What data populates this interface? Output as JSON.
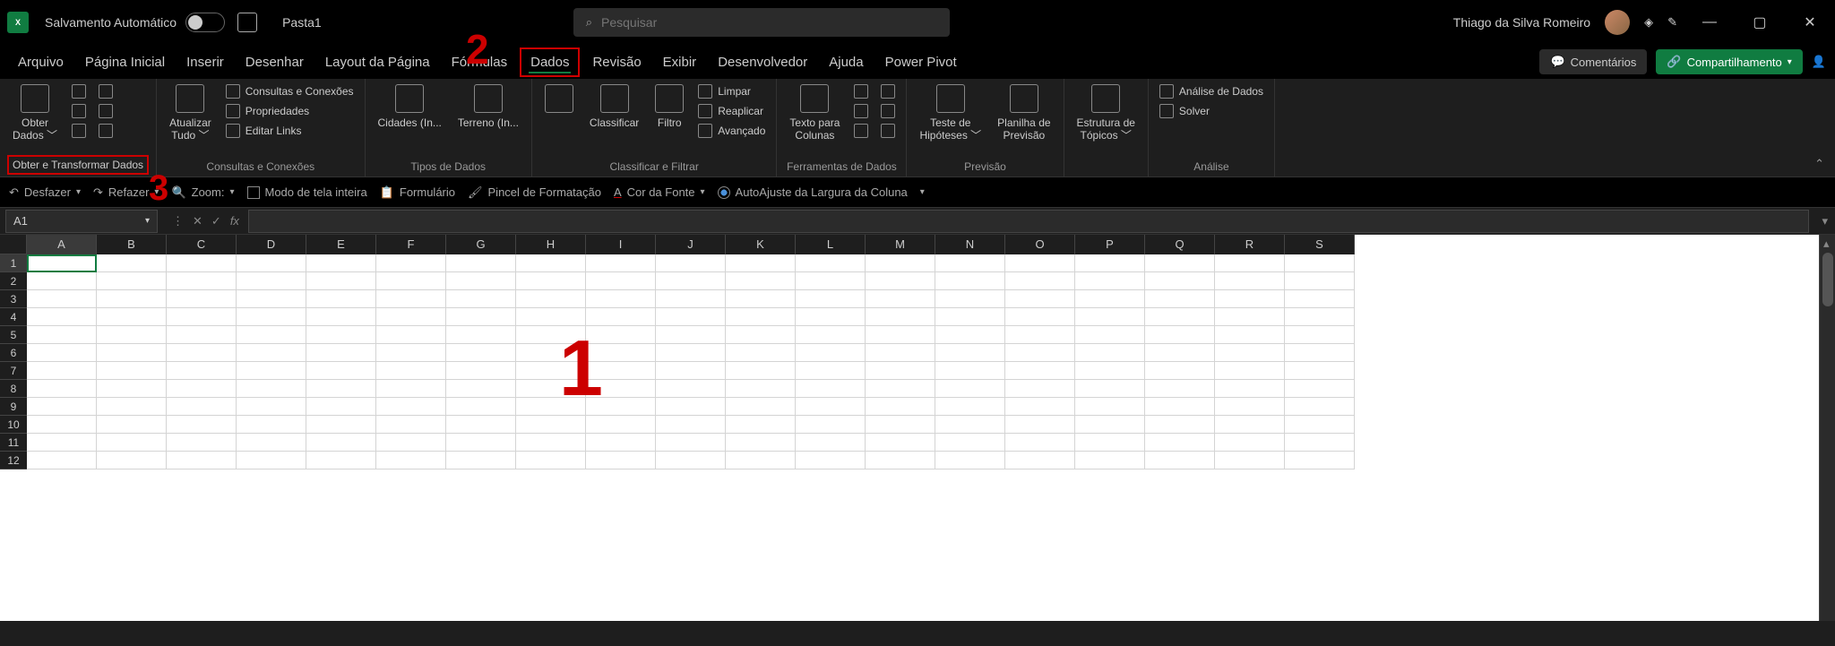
{
  "title_bar": {
    "app_abbrev": "X",
    "autosave_label": "Salvamento Automático",
    "doc_name": "Pasta1",
    "search_placeholder": "Pesquisar",
    "user_name": "Thiago da Silva Romeiro"
  },
  "tabs": {
    "items": [
      "Arquivo",
      "Página Inicial",
      "Inserir",
      "Desenhar",
      "Layout da Página",
      "Fórmulas",
      "Dados",
      "Revisão",
      "Exibir",
      "Desenvolvedor",
      "Ajuda",
      "Power Pivot"
    ],
    "active_index": 6,
    "comments": "Comentários",
    "share": "Compartilhamento"
  },
  "ribbon": {
    "groups": [
      {
        "label": "Obter e Transformar Dados",
        "highlight": true,
        "big": [
          {
            "label": "Obter\nDados ﹀"
          }
        ],
        "small_cols": [
          [
            {
              "label": ""
            },
            {
              "label": ""
            },
            {
              "label": ""
            }
          ],
          [
            {
              "label": ""
            },
            {
              "label": ""
            },
            {
              "label": ""
            }
          ]
        ]
      },
      {
        "label": "Consultas e Conexões",
        "big": [
          {
            "label": "Atualizar\nTudo ﹀"
          }
        ],
        "small_cols": [
          [
            {
              "label": "Consultas e Conexões"
            },
            {
              "label": "Propriedades"
            },
            {
              "label": "Editar Links"
            }
          ]
        ]
      },
      {
        "label": "Tipos de Dados",
        "big": [
          {
            "label": "Cidades (In..."
          },
          {
            "label": "Terreno (In..."
          }
        ],
        "small_cols": []
      },
      {
        "label": "Classificar e Filtrar",
        "big": [
          {
            "label": ""
          },
          {
            "label": "Classificar"
          },
          {
            "label": "Filtro"
          }
        ],
        "small_cols": [
          [
            {
              "label": "Limpar"
            },
            {
              "label": "Reaplicar"
            },
            {
              "label": "Avançado"
            }
          ]
        ]
      },
      {
        "label": "Ferramentas de Dados",
        "big": [
          {
            "label": "Texto para\nColunas"
          }
        ],
        "small_cols": [
          [
            {
              "label": ""
            },
            {
              "label": ""
            },
            {
              "label": ""
            }
          ],
          [
            {
              "label": ""
            },
            {
              "label": ""
            },
            {
              "label": ""
            }
          ]
        ]
      },
      {
        "label": "Previsão",
        "big": [
          {
            "label": "Teste de\nHipóteses ﹀"
          },
          {
            "label": "Planilha de\nPrevisão"
          }
        ],
        "small_cols": []
      },
      {
        "label": "",
        "big": [
          {
            "label": "Estrutura de\nTópicos ﹀"
          }
        ],
        "small_cols": []
      },
      {
        "label": "Análise",
        "big": [],
        "small_cols": [
          [
            {
              "label": "Análise de Dados"
            },
            {
              "label": "Solver"
            }
          ]
        ]
      }
    ]
  },
  "qat": {
    "undo": "Desfazer",
    "redo": "Refazer",
    "zoom": "Zoom:",
    "fullscreen": "Modo de tela inteira",
    "form": "Formulário",
    "format_painter": "Pincel de Formatação",
    "font_color": "Cor da Fonte",
    "autofit": "AutoAjuste da Largura da Coluna"
  },
  "formula_bar": {
    "name_box": "A1",
    "fx": "fx"
  },
  "grid": {
    "columns": [
      "A",
      "B",
      "C",
      "D",
      "E",
      "F",
      "G",
      "H",
      "I",
      "J",
      "K",
      "L",
      "M",
      "N",
      "O",
      "P",
      "Q",
      "R",
      "S"
    ],
    "rows": [
      "1",
      "2",
      "3",
      "4",
      "5",
      "6",
      "7",
      "8",
      "9",
      "10",
      "11",
      "12"
    ],
    "selected_cell": "A1"
  },
  "annotations": {
    "n1": "1",
    "n2": "2",
    "n3": "3"
  }
}
